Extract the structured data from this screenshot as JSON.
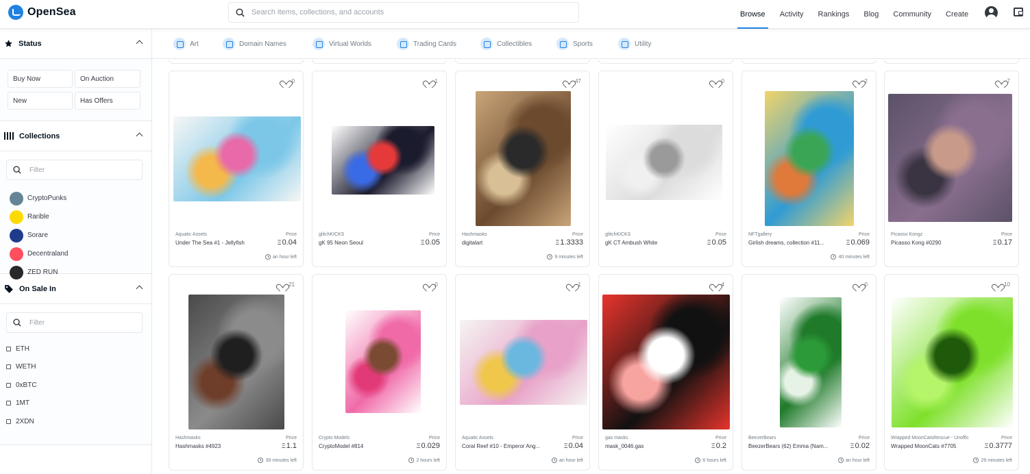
{
  "header": {
    "logo_text": "OpenSea",
    "search_placeholder": "Search items, collections, and accounts",
    "nav": [
      "Browse",
      "Activity",
      "Rankings",
      "Blog",
      "Community",
      "Create"
    ],
    "active_nav": "Browse"
  },
  "sidebar": {
    "status": {
      "title": "Status",
      "buttons": [
        "Buy Now",
        "On Auction",
        "New",
        "Has Offers"
      ]
    },
    "collections": {
      "title": "Collections",
      "filter_placeholder": "Filter",
      "items": [
        {
          "name": "CryptoPunks",
          "color": "#638596"
        },
        {
          "name": "Rarible",
          "color": "#feda03"
        },
        {
          "name": "Sorare",
          "color": "#1f3b8c"
        },
        {
          "name": "Decentraland",
          "color": "#ff4f5e"
        },
        {
          "name": "ZED RUN",
          "color": "#27292b"
        }
      ]
    },
    "on_sale_in": {
      "title": "On Sale In",
      "filter_placeholder": "Filter",
      "tokens": [
        "ETH",
        "WETH",
        "0xBTC",
        "1MT",
        "2XDN"
      ]
    }
  },
  "categories": [
    "Art",
    "Domain Names",
    "Virtual Worlds",
    "Trading Cards",
    "Collectibles",
    "Sports",
    "Utility"
  ],
  "price_label": "Price",
  "eth_symbol": "Ξ",
  "cards": [
    {
      "favorites": "0",
      "collection": "Aquatic Assets",
      "name": "Under The Sea #1 - Jellyfish",
      "price": "0.04",
      "time_left": "an hour left",
      "art_colors": [
        "#f7f7f5",
        "#7cc7e8",
        "#e86aa8",
        "#f5b84a"
      ]
    },
    {
      "favorites": "1",
      "collection": "glitchKICKS",
      "name": "gK 95 Neon Seoul",
      "price": "0.05",
      "time_left": "",
      "art_colors": [
        "#ffffff",
        "#1b1b2e",
        "#e63a3a",
        "#3a6be6"
      ]
    },
    {
      "favorites": "47",
      "collection": "Hashmasks",
      "name": "digitalart",
      "price": "1.3333",
      "time_left": "9 minutes left",
      "art_colors": [
        "#caa57a",
        "#6b4a2e",
        "#2a2a2a",
        "#d9bf95"
      ]
    },
    {
      "favorites": "0",
      "collection": "glitchKICKS",
      "name": "gK CT Ambush White",
      "price": "0.05",
      "time_left": "",
      "art_colors": [
        "#ffffff",
        "#dcdcdc",
        "#9a9a9a",
        "#f0f0f0"
      ]
    },
    {
      "favorites": "2",
      "collection": "NFTgallery",
      "name": "Girlish dreams, collection #11...",
      "price": "0.069",
      "time_left": "40 minutes left",
      "art_colors": [
        "#f2d46b",
        "#2f9bd4",
        "#3aa655",
        "#e07a3a"
      ]
    },
    {
      "favorites": "7",
      "collection": "Picasso Kongz",
      "name": "Picasso Kong #0290",
      "price": "0.17",
      "time_left": "",
      "art_colors": [
        "#5b5268",
        "#8a6f8f",
        "#c79a8a",
        "#3a3442"
      ]
    },
    {
      "favorites": "21",
      "collection": "Hashmasks",
      "name": "Hashmasks #4923",
      "price": "1.1",
      "time_left": "39 minutes left",
      "art_colors": [
        "#4a4a4a",
        "#8b8b8b",
        "#1f1f1f",
        "#6e3e2a"
      ]
    },
    {
      "favorites": "0",
      "collection": "Crypto Models",
      "name": "CryptoModel #814",
      "price": "0.029",
      "time_left": "2 hours left",
      "art_colors": [
        "#ffffff",
        "#f06aa8",
        "#7a4a32",
        "#e23a78"
      ]
    },
    {
      "favorites": "1",
      "collection": "Aquatic Assets",
      "name": "Coral Reef #10 - Emperor Ang...",
      "price": "0.04",
      "time_left": "an hour left",
      "art_colors": [
        "#f5f5f2",
        "#e8a1c8",
        "#6ab7e0",
        "#f0c74a"
      ]
    },
    {
      "favorites": "4",
      "collection": "gas masks",
      "name": "mask_0046.gas",
      "price": "0.2",
      "time_left": "6 hours left",
      "art_colors": [
        "#e8342c",
        "#111111",
        "#ffffff",
        "#f7a3a0"
      ]
    },
    {
      "favorites": "0",
      "collection": "BeezerBears",
      "name": "BeezerBears (62) Emma (Nam...",
      "price": "0.02",
      "time_left": "an hour left",
      "art_colors": [
        "#ffffff",
        "#1f7a2a",
        "#2c9a38",
        "#e6f2e6"
      ]
    },
    {
      "favorites": "10",
      "collection": "Wrapped MoonCatsRescue - Unoffic",
      "name": "Wrapped MoonCats #7705",
      "price": "0.3777",
      "time_left": "29 minutes left",
      "art_colors": [
        "#ffffff",
        "#7ee02a",
        "#1f5a0a",
        "#b5f56a"
      ]
    }
  ]
}
